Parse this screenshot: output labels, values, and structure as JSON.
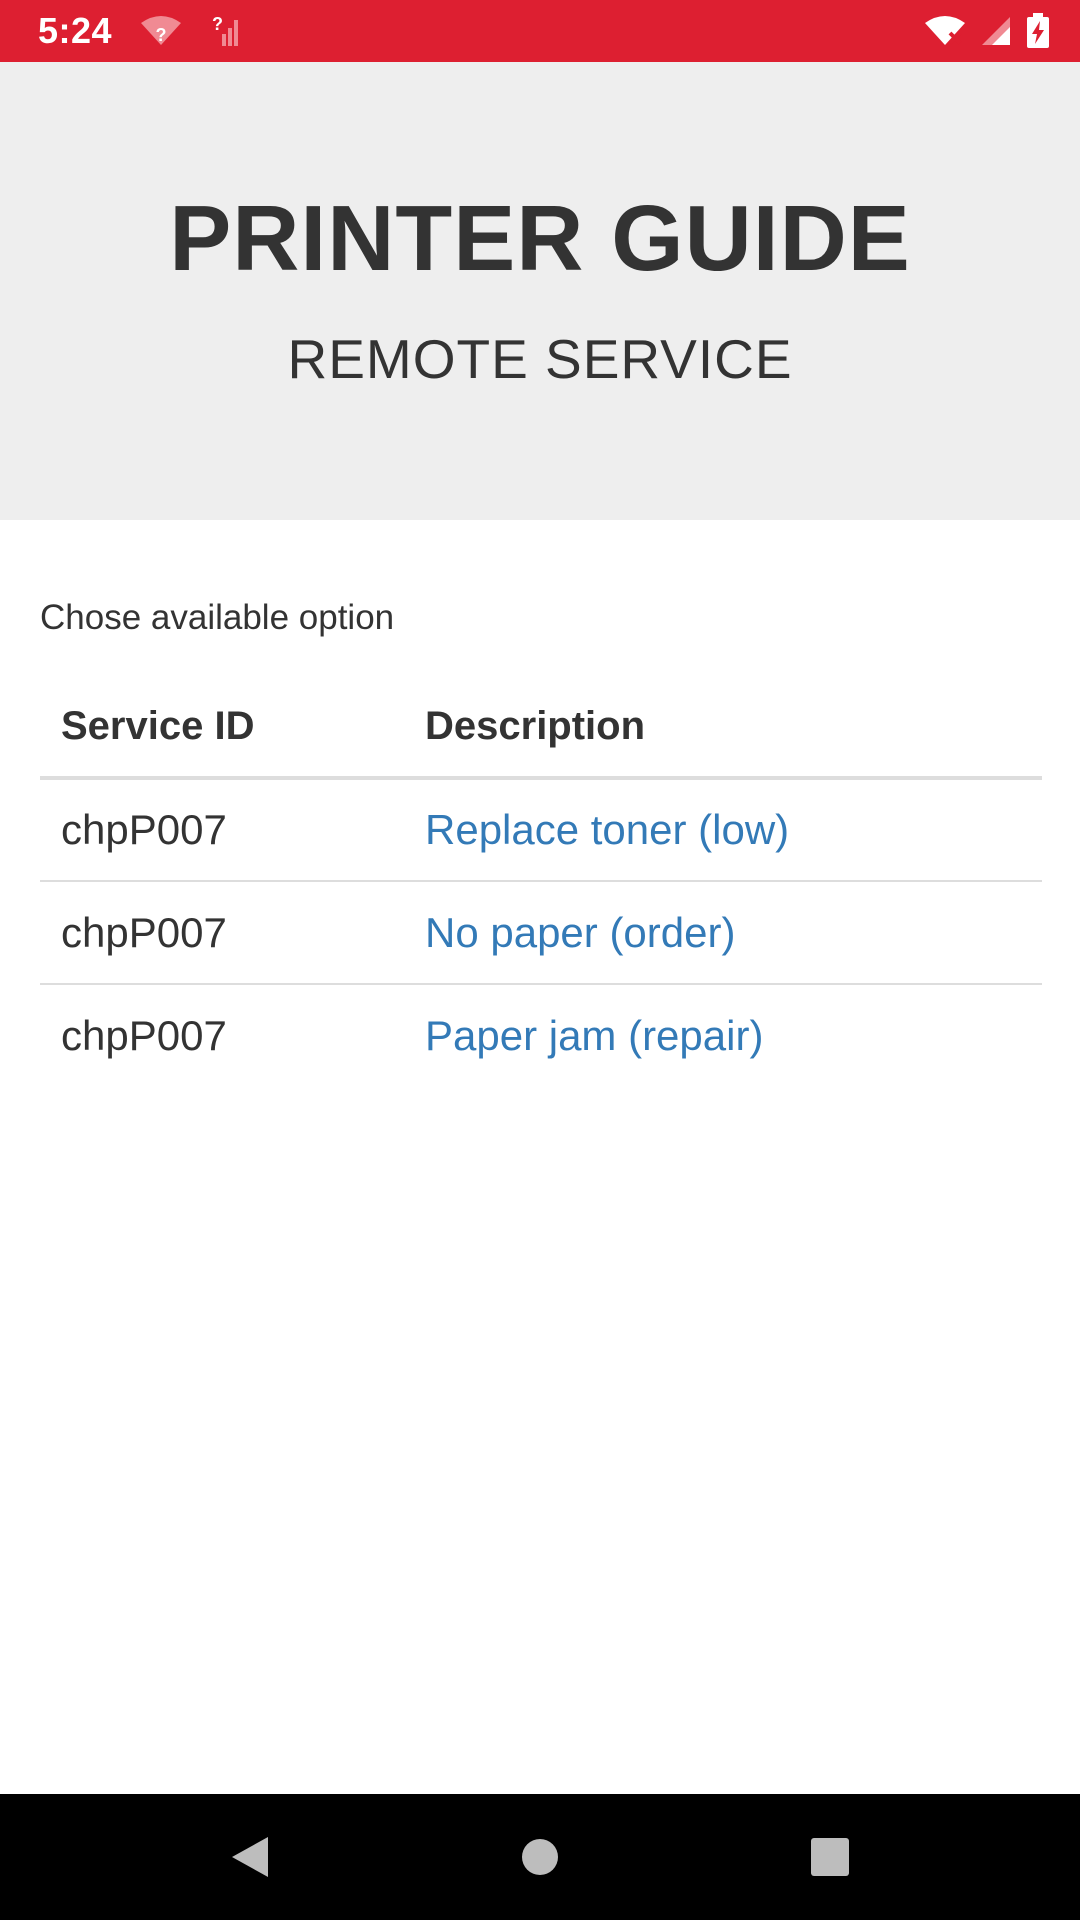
{
  "status_bar": {
    "time": "5:24",
    "color": "#dd1f31",
    "icons": [
      "wifi-unknown-icon",
      "signal-unknown-icon",
      "wifi-off-icon",
      "cell-signal-icon",
      "battery-charging-icon"
    ]
  },
  "header": {
    "title": "PRINTER GUIDE",
    "subtitle": "REMOTE SERVICE"
  },
  "main": {
    "prompt": "Chose available option",
    "table": {
      "columns": [
        "Service ID",
        "Description"
      ],
      "rows": [
        {
          "service_id": "chpP007",
          "description": "Replace toner (low)"
        },
        {
          "service_id": "chpP007",
          "description": "No paper (order)"
        },
        {
          "service_id": "chpP007",
          "description": "Paper jam (repair)"
        }
      ]
    }
  },
  "nav_bar": {
    "icons": [
      "back-icon",
      "home-icon",
      "recents-icon"
    ]
  },
  "colors": {
    "accent": "#dd1f31",
    "link": "#337ab7",
    "header_bg": "#eeeeee"
  }
}
